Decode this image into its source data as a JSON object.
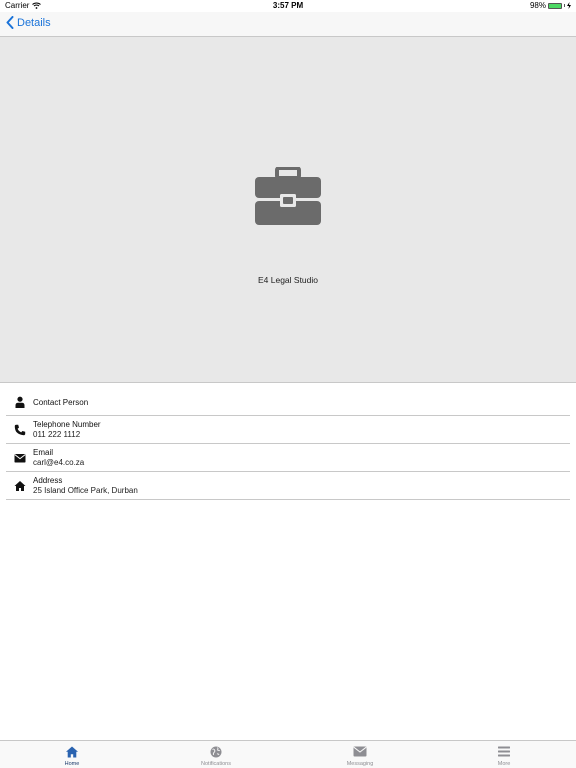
{
  "status_bar": {
    "carrier": "Carrier",
    "time": "3:57 PM",
    "battery_percent": "98%",
    "battery_level": 0.98
  },
  "nav": {
    "back_label": "Details"
  },
  "hero": {
    "company_name": "E4 Legal Studio"
  },
  "contacts": [
    {
      "icon": "person-icon",
      "label": "Contact Person",
      "value": ""
    },
    {
      "icon": "phone-icon",
      "label": "Telephone Number",
      "value": "011 222 1112"
    },
    {
      "icon": "envelope-icon",
      "label": "Email",
      "value": "carl@e4.co.za"
    },
    {
      "icon": "home-icon",
      "label": "Address",
      "value": "25 Island Office Park, Durban"
    }
  ],
  "tabs": [
    {
      "icon": "home-icon",
      "label": "Home",
      "active": true
    },
    {
      "icon": "globe-icon",
      "label": "Notifications",
      "active": false
    },
    {
      "icon": "envelope-icon",
      "label": "Messaging",
      "active": false
    },
    {
      "icon": "menu-icon",
      "label": "More",
      "active": false
    }
  ],
  "colors": {
    "accent": "#1a73d9",
    "hero_bg": "#e8e8e8",
    "icon_gray": "#6b6b6b",
    "tab_active": "#1a3a6b",
    "tab_inactive": "#8e8e93"
  }
}
